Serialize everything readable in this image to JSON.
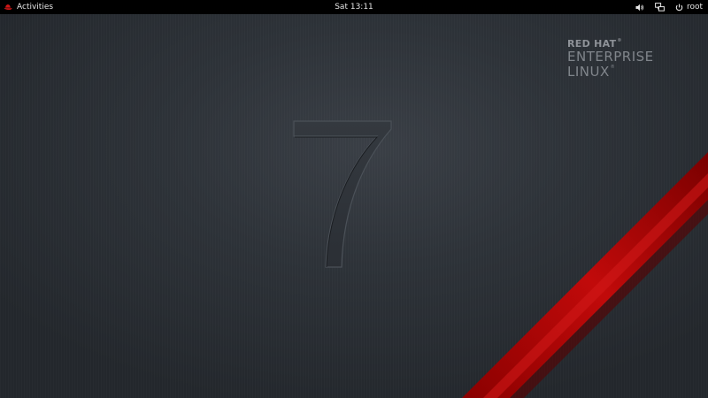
{
  "topbar": {
    "activities_label": "Activities",
    "clock": "Sat 13:11",
    "user_label": "root",
    "icons": {
      "activities": "red-hat-fedora-icon",
      "volume": "volume-icon",
      "network": "network-icon",
      "power": "power-icon"
    }
  },
  "desktop": {
    "logo": {
      "line1": "RED HAT",
      "line2": "ENTERPRISE",
      "line3": "LINUX"
    },
    "version_numeral": "7",
    "colors": {
      "background": "#2d3238",
      "stripe": "#c00000",
      "logo_text": "#8b8f95"
    }
  }
}
